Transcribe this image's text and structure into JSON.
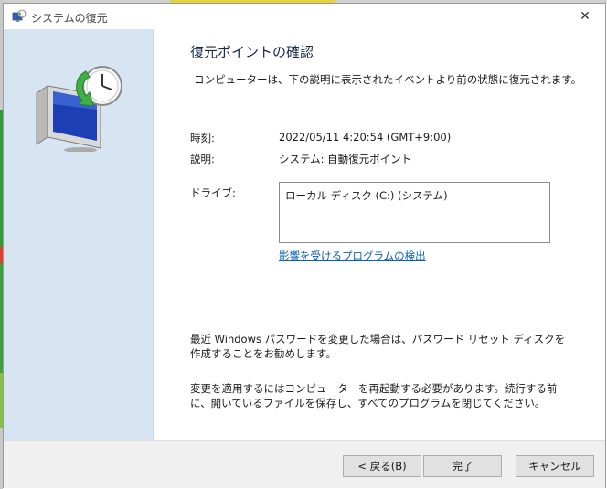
{
  "window": {
    "title": "システムの復元",
    "close_symbol": "✕",
    "icon": "system-restore-icon"
  },
  "content": {
    "heading": "復元ポイントの確認",
    "intro": "コンピューターは、下の説明に表示されたイベントより前の状態に復元されます。",
    "fields": {
      "time_label": "時刻:",
      "time_value": "2022/05/11 4:20:54 (GMT+9:00)",
      "description_label": "説明:",
      "description_value": "システム: 自動復元ポイント",
      "drives_label": "ドライブ:",
      "drives": [
        "ローカル ディスク (C:) (システム)"
      ]
    },
    "scan_link": "影響を受けるプログラムの検出",
    "note_password": "最近 Windows パスワードを変更した場合は、パスワード リセット ディスクを作成することをお勧めします。",
    "note_restart": "変更を適用するにはコンピューターを再起動する必要があります。続行する前に、開いているファイルを保存し、すべてのプログラムを閉じてください。"
  },
  "buttons": {
    "back": "< 戻る(B)",
    "finish": "完了",
    "cancel": "キャンセル"
  },
  "colors": {
    "sidebar": "#d7e4f2",
    "link": "#0b5fb0",
    "footer": "#f0f0f0"
  }
}
